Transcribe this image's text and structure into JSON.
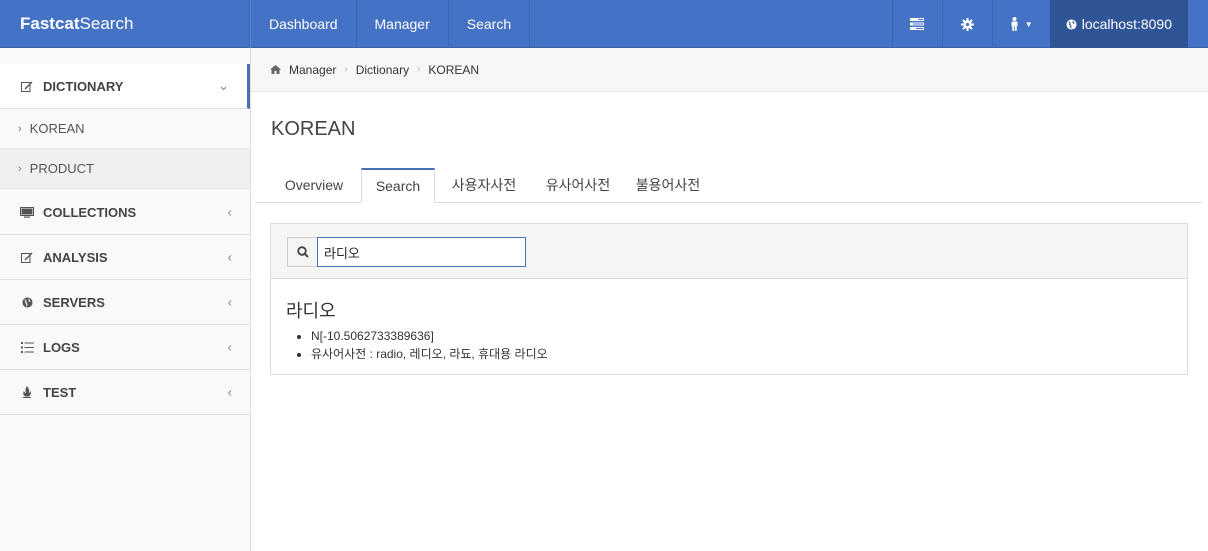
{
  "brand": {
    "bold": "Fastcat",
    "rest": "Search"
  },
  "topnav": [
    "Dashboard",
    "Manager",
    "Search"
  ],
  "server": {
    "label": "localhost:8090"
  },
  "sidebar": {
    "items": [
      {
        "label": "DICTIONARY",
        "icon": "edit-icon"
      },
      {
        "label": "COLLECTIONS",
        "icon": "monitor-icon"
      },
      {
        "label": "ANALYSIS",
        "icon": "edit-icon"
      },
      {
        "label": "SERVERS",
        "icon": "globe-icon"
      },
      {
        "label": "LOGS",
        "icon": "list-icon"
      },
      {
        "label": "TEST",
        "icon": "fire-icon"
      }
    ],
    "sub": [
      "KOREAN",
      "PRODUCT"
    ]
  },
  "breadcrumb": [
    "Manager",
    "Dictionary",
    "KOREAN"
  ],
  "page": {
    "title": "KOREAN"
  },
  "tabs": [
    "Overview",
    "Search",
    "사용자사전",
    "유사어사전",
    "불용어사전"
  ],
  "search": {
    "value": "라디오"
  },
  "result": {
    "term": "라디오",
    "lines": [
      "N[-10.5062733389636]",
      "유사어사전 : radio, 레디오, 라됴, 휴대용 라디오"
    ]
  },
  "colors": {
    "navbar": "#4472c4",
    "server_bg": "#2f5597",
    "accent": "#4a6fb5"
  }
}
